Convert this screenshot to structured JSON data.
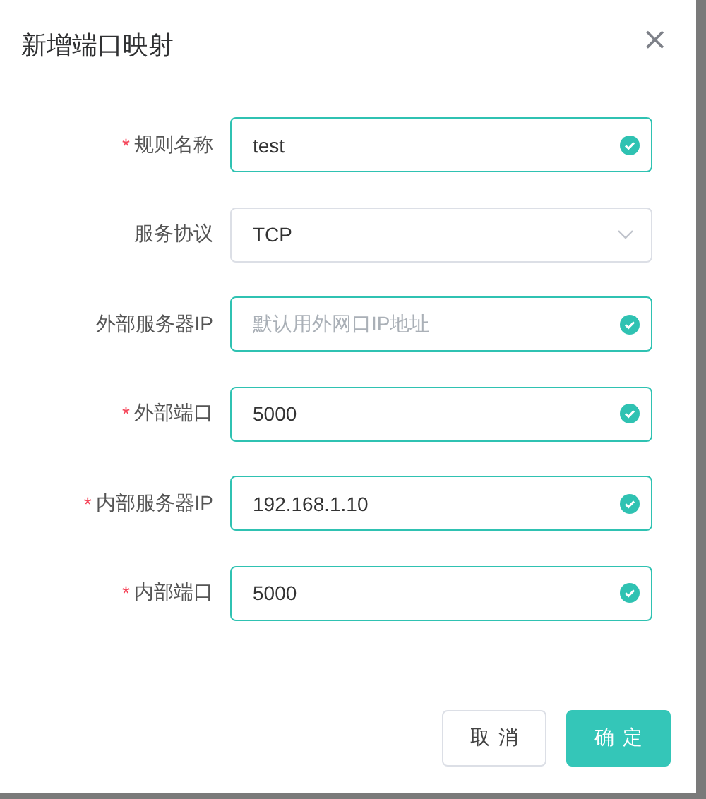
{
  "dialog": {
    "title": "新增端口映射",
    "close": "×",
    "required_mark": "*"
  },
  "fields": [
    {
      "kind": "input",
      "label": "规则名称",
      "required": true,
      "value": "test",
      "validated": true
    },
    {
      "kind": "select",
      "label": "服务协议",
      "required": false,
      "value": "TCP",
      "validated": false
    },
    {
      "kind": "input",
      "label": "外部服务器IP",
      "required": false,
      "placeholder": "默认用外网口IP地址",
      "validated": true
    },
    {
      "kind": "input",
      "label": "外部端口",
      "required": true,
      "value": "5000",
      "validated": true
    },
    {
      "kind": "input",
      "label": "内部服务器IP",
      "required": true,
      "value": "192.168.1.10",
      "validated": true
    },
    {
      "kind": "input",
      "label": "内部端口",
      "required": true,
      "value": "5000",
      "validated": true
    }
  ],
  "buttons": [
    {
      "label": "取消",
      "kind": "default"
    },
    {
      "label": "确定",
      "kind": "primary"
    }
  ]
}
